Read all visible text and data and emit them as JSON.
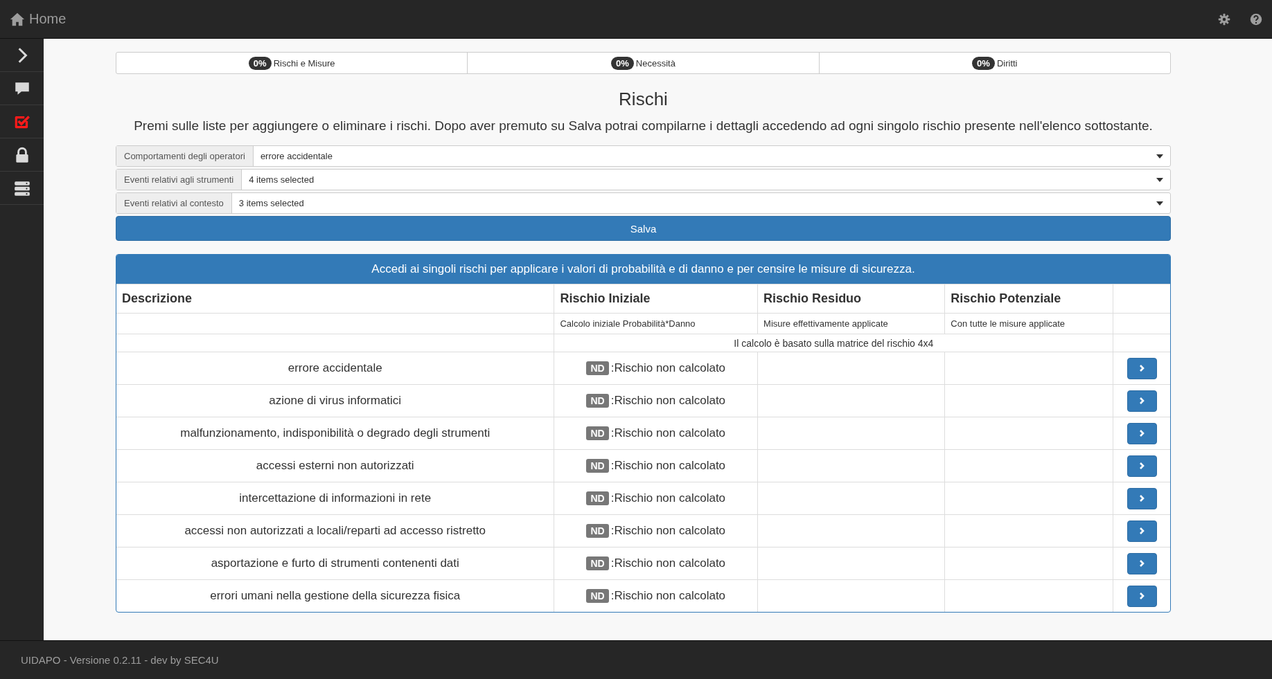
{
  "topbar": {
    "title": "Home"
  },
  "sidebar": {
    "items": [
      {
        "kind": "expand",
        "selected": false
      },
      {
        "kind": "chat",
        "selected": false
      },
      {
        "kind": "checklist",
        "selected": true
      },
      {
        "kind": "lock",
        "selected": false
      },
      {
        "kind": "server",
        "selected": false
      }
    ]
  },
  "progress_tabs": [
    {
      "badge": "0%",
      "label": "Rischi e Misure"
    },
    {
      "badge": "0%",
      "label": "Necessità"
    },
    {
      "badge": "0%",
      "label": "Diritti"
    }
  ],
  "title": "Rischi",
  "instructions": "Premi sulle liste per aggiungere o eliminare i rischi. Dopo aver premuto su Salva potrai compilarne i dettagli accedendo ad ogni singolo rischio presente nell'elenco sottostante.",
  "filters": [
    {
      "label": "Comportamenti degli operatori",
      "value": "errore accidentale"
    },
    {
      "label": "Eventi relativi agli strumenti",
      "value": "4 items selected"
    },
    {
      "label": "Eventi relativi al contesto",
      "value": "3 items selected"
    }
  ],
  "save_button": "Salva",
  "panel": {
    "heading": "Accedi ai singoli rischi per applicare i valori di probabilità e di danno e per censire le misure di sicurezza.",
    "columns": [
      "Descrizione",
      "Rischio Iniziale",
      "Rischio Residuo",
      "Rischio Potenziale"
    ],
    "subheaders": [
      "Calcolo iniziale Probabilità*Danno",
      "Misure effettivamente applicate",
      "Con tutte le misure applicate"
    ],
    "note": "Il calcolo è basato sulla matrice del rischio 4x4",
    "rows": [
      {
        "description": "errore accidentale",
        "badge": "ND",
        "status": ":Rischio non calcolato"
      },
      {
        "description": "azione di virus informatici",
        "badge": "ND",
        "status": ":Rischio non calcolato"
      },
      {
        "description": "malfunzionamento, indisponibilità o degrado degli strumenti",
        "badge": "ND",
        "status": ":Rischio non calcolato"
      },
      {
        "description": "accessi esterni non autorizzati",
        "badge": "ND",
        "status": ":Rischio non calcolato"
      },
      {
        "description": "intercettazione di informazioni in rete",
        "badge": "ND",
        "status": ":Rischio non calcolato"
      },
      {
        "description": "accessi non autorizzati a locali/reparti ad accesso ristretto",
        "badge": "ND",
        "status": ":Rischio non calcolato"
      },
      {
        "description": "asportazione e furto di strumenti contenenti dati",
        "badge": "ND",
        "status": ":Rischio non calcolato"
      },
      {
        "description": "errori umani nella gestione della sicurezza fisica",
        "badge": "ND",
        "status": ":Rischio non calcolato"
      }
    ]
  },
  "footer": "UIDAPO - Versione 0.2.11 - dev by SEC4U"
}
